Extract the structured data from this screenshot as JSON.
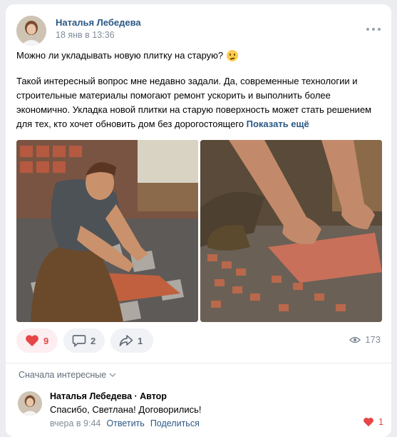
{
  "post": {
    "author": "Наталья Лебедева",
    "date": "18 янв в 13:36",
    "question": "Можно ли укладывать новую плитку на старую?",
    "body": "Такой интересный вопрос мне недавно задали. Да, современные технологии и строительные материалы помогают ремонт ускорить и выполнить более экономично. Укладка новой плитки на старую поверхность может стать решением для тех, кто хочет обновить дом без дорогостоящего",
    "show_more": "Показать ещё"
  },
  "actions": {
    "likes": "9",
    "comments": "2",
    "shares": "1",
    "views": "173"
  },
  "comments_section": {
    "sort_label": "Сначала интересные"
  },
  "comment": {
    "author": "Наталья Лебедева",
    "role": " · Автор",
    "text": "Спасибо, Светлана! Договорились!",
    "time": "вчера в 9:44",
    "reply": "Ответить",
    "share": "Поделиться",
    "likes": "1"
  },
  "icons": {
    "more": "more-horizontal-icon",
    "like": "heart-icon",
    "comment": "comment-icon",
    "share": "share-icon",
    "views": "eye-icon",
    "sort": "chevron-down-icon"
  },
  "colors": {
    "link": "#2a5885",
    "like_active": "#e64646",
    "secondary": "#818c99",
    "pill_bg": "#f0f2f5"
  }
}
